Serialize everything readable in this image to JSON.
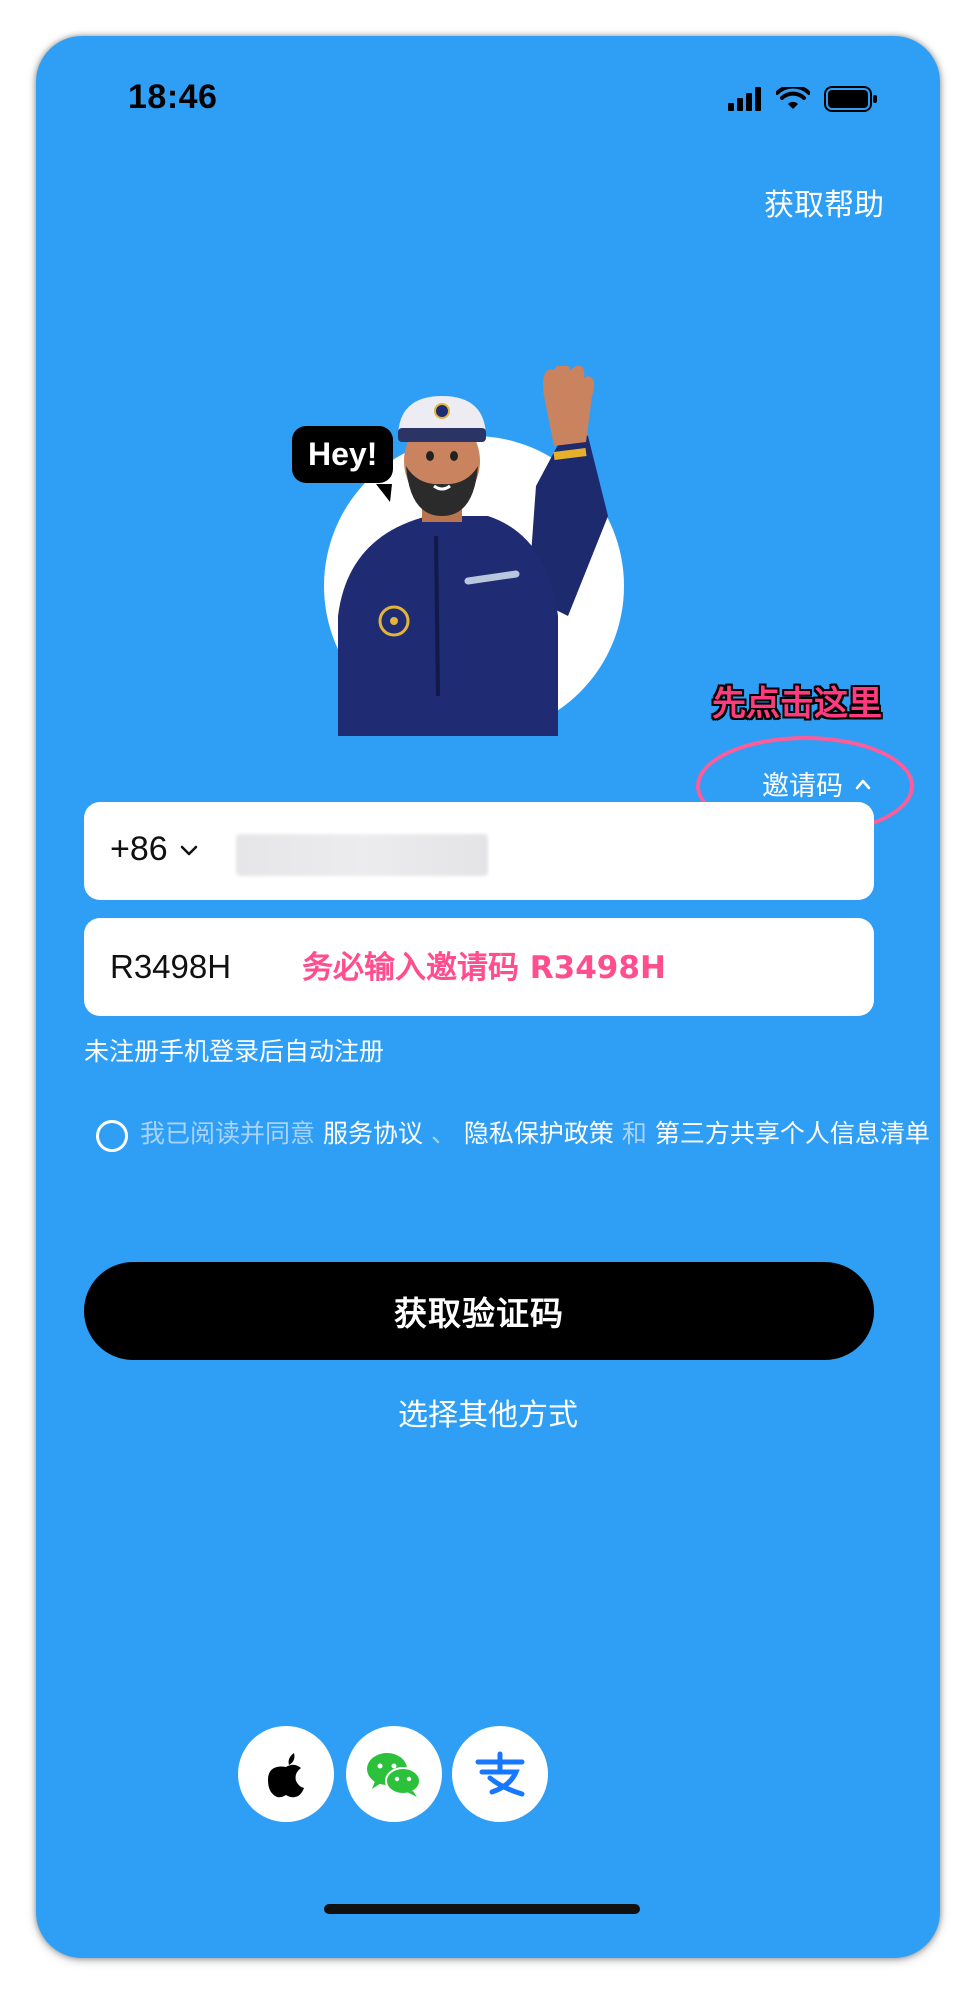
{
  "status_bar": {
    "time": "18:46"
  },
  "header": {
    "help_label": "获取帮助"
  },
  "hero": {
    "speech_bubble": "Hey!"
  },
  "annotations": {
    "click_here": "先点击这里",
    "must_enter_invite": "务必输入邀请码 R3498H"
  },
  "invite_toggle": {
    "label": "邀请码",
    "chevron": "^"
  },
  "phone_field": {
    "country_code": "+86",
    "value": ""
  },
  "invite_field": {
    "value": "R3498H"
  },
  "notice": "未注册手机登录后自动注册",
  "agreement": {
    "prefix": "我已阅读并同意",
    "service": "服务协议",
    "sep": "、",
    "privacy": "隐私保护政策",
    "and": "和",
    "third_party": "第三方共享个人信息清单"
  },
  "primary_button": "获取验证码",
  "alt_login": "选择其他方式",
  "social_login": [
    "apple-icon",
    "wechat-icon",
    "alipay-icon"
  ],
  "colors": {
    "background": "#2f9ff5",
    "accent_pink": "#ff4d8d",
    "button": "#000000"
  }
}
